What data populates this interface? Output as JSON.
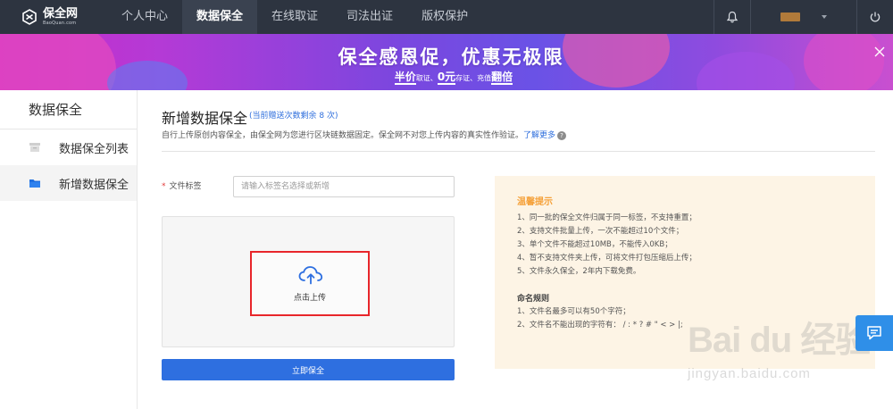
{
  "brand": {
    "name": "保全网",
    "sub": "BaoQuan.com"
  },
  "nav": {
    "items": [
      {
        "label": "个人中心"
      },
      {
        "label": "数据保全"
      },
      {
        "label": "在线取证"
      },
      {
        "label": "司法出证"
      },
      {
        "label": "版权保护"
      }
    ],
    "active_index": 1
  },
  "banner": {
    "title": "保全感恩促，优惠无极限",
    "sub_1_bold": "半价",
    "sub_1": "取证、",
    "sub_2_bold": "0元",
    "sub_2": "存证、充值",
    "sub_3_bold": "翻倍"
  },
  "sidebar": {
    "title": "数据保全",
    "items": [
      {
        "label": "数据保全列表"
      },
      {
        "label": "新增数据保全"
      }
    ],
    "active_index": 1
  },
  "main": {
    "title": "新增数据保全",
    "title_note": "(当前赠送次数剩余 8 次)",
    "description": "自行上传原创内容保全，由保全网为您进行区块链数据固定。保全网不对您上传内容的真实性作验证。",
    "learn_more": "了解更多",
    "help_mark": "?",
    "field_label": "文件标签",
    "required_mark": "*",
    "field_placeholder": "请输入标签名选择或新增",
    "upload_label": "点击上传",
    "submit_label": "立即保全"
  },
  "tips": {
    "title": "温馨提示",
    "items": [
      "1、同一批的保全文件归属于同一标签，不支持重置；",
      "2、支持文件批量上传，一次不能超过10个文件；",
      "3、单个文件不能超过10MB，不能传入0KB；",
      "4、暂不支持文件夹上传，可将文件打包压缩后上传；",
      "5、文件永久保全，2年内下载免费。"
    ],
    "rules_title": "命名规则",
    "rules": [
      "1、文件名最多可以有50个字符；",
      "2、文件名不能出现的字符有： / : * ? # \" < > |;"
    ]
  },
  "watermark": {
    "main": "Bai du 经验",
    "sub": "jingyan.baidu.com"
  },
  "colors": {
    "nav_bg": "#2d3440",
    "primary": "#2e6fe0",
    "highlight_border": "#e8262b",
    "tips_bg": "#fdf4e5",
    "tips_title": "#f5a13a"
  }
}
